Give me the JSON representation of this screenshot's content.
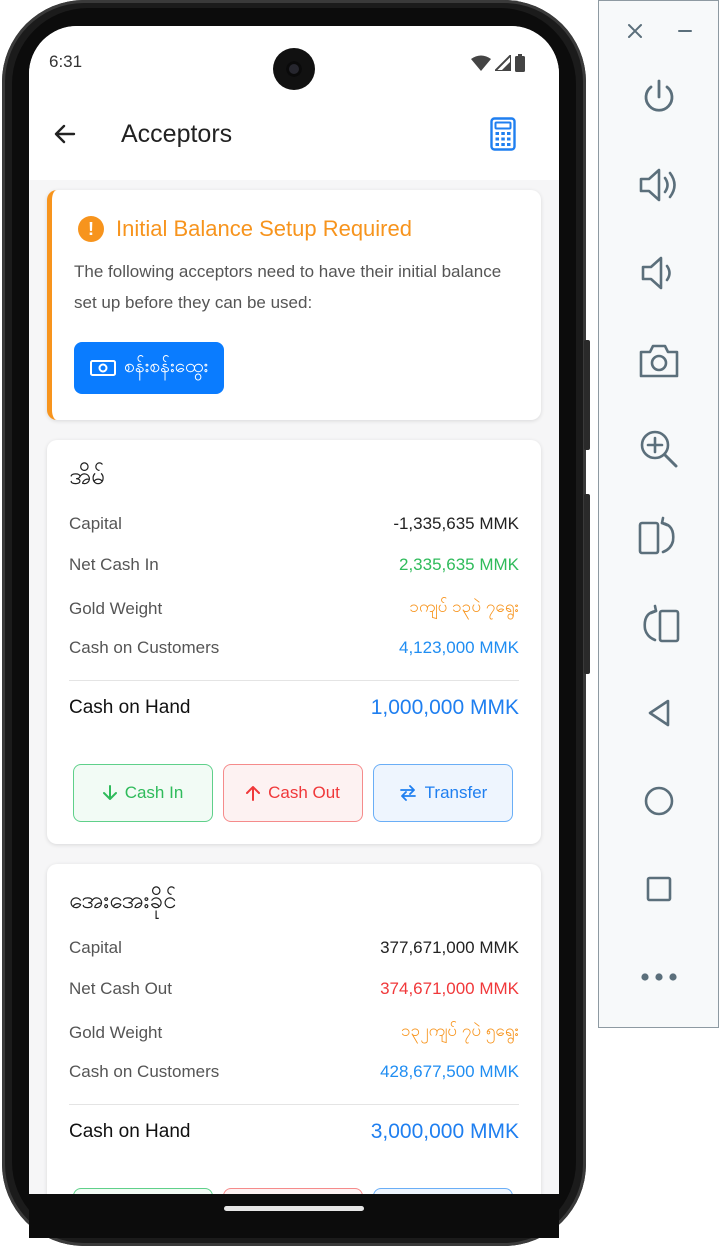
{
  "status_bar": {
    "time": "6:31"
  },
  "app_bar": {
    "title": "Acceptors"
  },
  "warning": {
    "title": "Initial Balance Setup Required",
    "message": "The following acceptors need to have their initial balance set up before they can be used:",
    "acceptor_button_label": "စန်းစန်းထွေး"
  },
  "acceptors": [
    {
      "name": "အိမ်",
      "capital_label": "Capital",
      "capital_value": "-1,335,635 MMK",
      "net_label": "Net Cash In",
      "net_value": "2,335,635 MMK",
      "gold_label": "Gold Weight",
      "gold_value": "၁ကျပ် ၁၃ပဲ ၇ရွေး",
      "customers_label": "Cash on Customers",
      "customers_value": "4,123,000 MMK",
      "hand_label": "Cash on Hand",
      "hand_value": "1,000,000 MMK",
      "cash_in_label": "Cash In",
      "cash_out_label": "Cash Out",
      "transfer_label": "Transfer"
    },
    {
      "name": "အေးအေးခိုင်",
      "capital_label": "Capital",
      "capital_value": "377,671,000 MMK",
      "net_label": "Net Cash Out",
      "net_value": "374,671,000 MMK",
      "gold_label": "Gold Weight",
      "gold_value": "၁၃၂ကျပ် ၇ပဲ ၅ရွေး",
      "customers_label": "Cash on Customers",
      "customers_value": "428,677,500 MMK",
      "hand_label": "Cash on Hand",
      "hand_value": "3,000,000 MMK"
    }
  ],
  "colors": {
    "warning": "#f7941d",
    "primary": "#0a7cff",
    "positive": "#2fbb5b",
    "negative": "#f0383a",
    "info": "#1f8df2"
  },
  "emulator_toolbar": {
    "icons": [
      "close-icon",
      "minimize-icon",
      "power-icon",
      "volume-up-icon",
      "volume-down-icon",
      "camera-icon",
      "zoom-icon",
      "rotate-left-icon",
      "rotate-right-icon",
      "back-icon",
      "home-icon",
      "overview-icon",
      "more-icon"
    ]
  }
}
